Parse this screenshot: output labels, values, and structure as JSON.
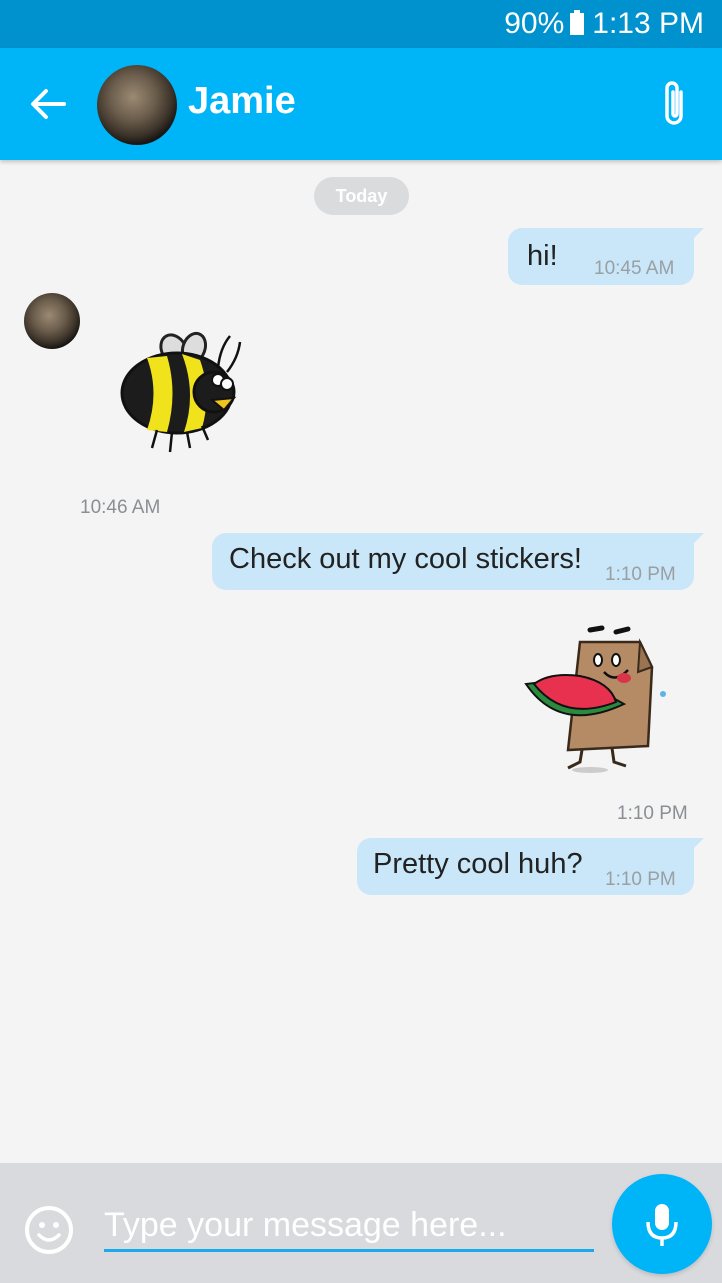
{
  "status_bar": {
    "battery": "90%",
    "time": "1:13 PM"
  },
  "header": {
    "contact_name": "Jamie"
  },
  "date_divider": "Today",
  "messages": [
    {
      "text": "hi!",
      "time": "10:45 AM"
    },
    {
      "sticker": "bee",
      "time": "10:46 AM"
    },
    {
      "text": "Check out my cool stickers!",
      "time": "1:10 PM"
    },
    {
      "sticker": "watermelon-bag",
      "time": "1:10 PM"
    },
    {
      "text": "Pretty cool huh?",
      "time": "1:10 PM"
    }
  ],
  "composer": {
    "placeholder": "Type your message here..."
  },
  "colors": {
    "appbar": "#00b4f8",
    "statusbar": "#0092cf",
    "bubble": "#c9e7f8",
    "accent": "#1aa9ec"
  }
}
